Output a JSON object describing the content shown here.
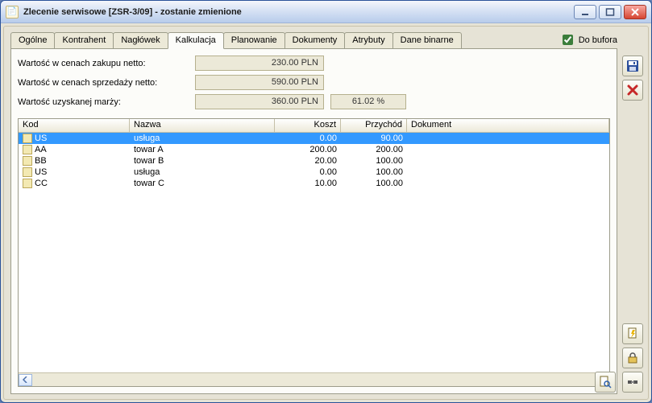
{
  "window": {
    "title": "Zlecenie serwisowe [ZSR-3/09]  - zostanie zmienione"
  },
  "tabs": [
    {
      "label": "Ogólne"
    },
    {
      "label": "Kontrahent"
    },
    {
      "label": "Nagłówek"
    },
    {
      "label": "Kalkulacja"
    },
    {
      "label": "Planowanie"
    },
    {
      "label": "Dokumenty"
    },
    {
      "label": "Atrybuty"
    },
    {
      "label": "Dane binarne"
    }
  ],
  "active_tab": 3,
  "buffer": {
    "label": "Do bufora",
    "checked": true
  },
  "summary": {
    "row1_label": "Wartość w cenach zakupu netto:",
    "row1_value": "230.00 PLN",
    "row2_label": "Wartość w cenach sprzedaży netto:",
    "row2_value": "590.00 PLN",
    "row3_label": "Wartość uzyskanej marży:",
    "row3_value": "360.00 PLN",
    "row3_pct": "61.02 %"
  },
  "grid": {
    "headers": {
      "kod": "Kod",
      "nazwa": "Nazwa",
      "koszt": "Koszt",
      "przychod": "Przychód",
      "dokument": "Dokument"
    },
    "rows": [
      {
        "kod": "US",
        "nazwa": "usługa",
        "koszt": "0.00",
        "przychod": "90.00",
        "dokument": "",
        "selected": true
      },
      {
        "kod": "AA",
        "nazwa": "towar A",
        "koszt": "200.00",
        "przychod": "200.00",
        "dokument": ""
      },
      {
        "kod": "BB",
        "nazwa": "towar B",
        "koszt": "20.00",
        "przychod": "100.00",
        "dokument": ""
      },
      {
        "kod": "US",
        "nazwa": "usługa",
        "koszt": "0.00",
        "przychod": "100.00",
        "dokument": ""
      },
      {
        "kod": "CC",
        "nazwa": "towar C",
        "koszt": "10.00",
        "przychod": "100.00",
        "dokument": ""
      }
    ]
  }
}
